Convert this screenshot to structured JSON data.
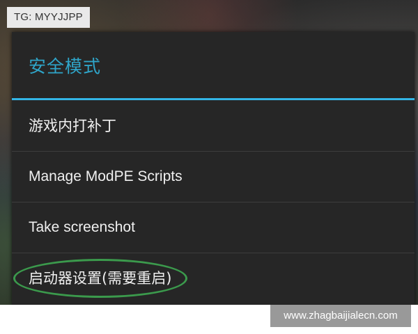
{
  "overlay": {
    "tg_watermark": "TG: MYYJJPP",
    "site_watermark": "www.zhagbaijialecn.com"
  },
  "dialog": {
    "title": "安全模式",
    "items": [
      {
        "label": "游戏内打补丁"
      },
      {
        "label": "Manage ModPE Scripts"
      },
      {
        "label": "Take screenshot"
      },
      {
        "label": "启动器设置(需要重启)",
        "highlighted": true
      }
    ]
  },
  "colors": {
    "title": "#2fa5c9",
    "divider_accent": "#33b5e5",
    "dialog_bg": "#262626",
    "highlight_oval": "#3b9a4c"
  }
}
